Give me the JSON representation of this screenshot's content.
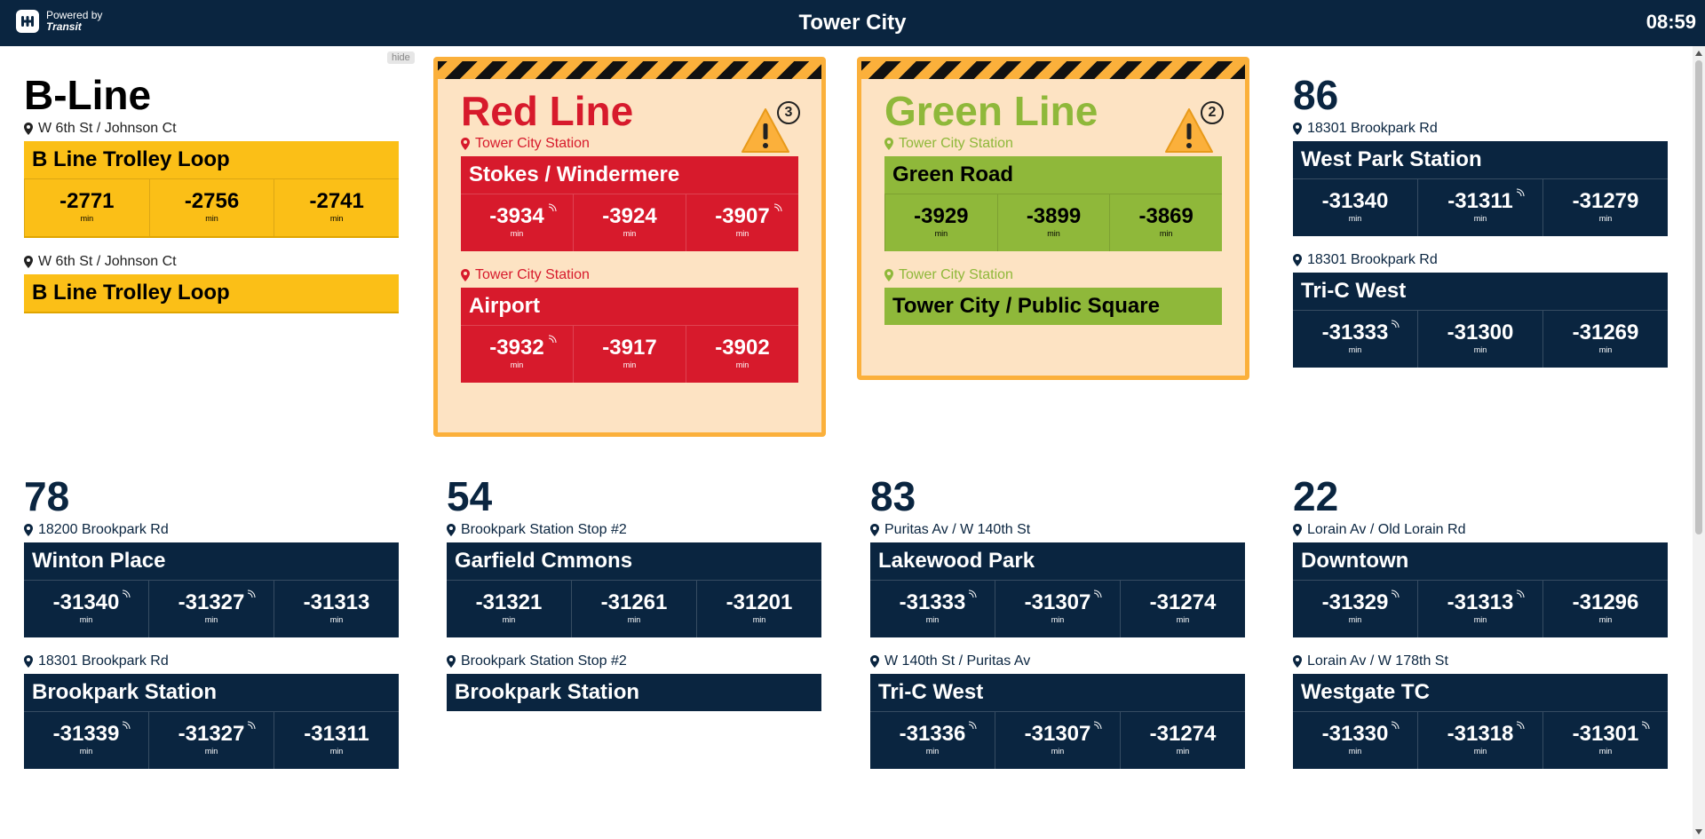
{
  "header": {
    "powered_by": "Powered by",
    "brand": "Transit",
    "title": "Tower City",
    "clock": "08:59"
  },
  "hide_label": "hide",
  "min_label": "min",
  "colors": {
    "navy": "#0a2540",
    "yellow": "#fbbf17",
    "red": "#d71a2c",
    "green": "#8fb83a",
    "alert_bg": "#fde3c3",
    "alert_border": "#fbb03b"
  },
  "bline": {
    "name": "B-Line",
    "groups": [
      {
        "stop": "W 6th St / Johnson Ct",
        "destination": "B Line Trolley Loop",
        "times": [
          "-2771",
          "-2756",
          "-2741"
        ]
      },
      {
        "stop": "W 6th St / Johnson Ct",
        "destination": "B Line Trolley Loop"
      }
    ]
  },
  "red_line": {
    "name": "Red Line",
    "alert_count": "3",
    "groups": [
      {
        "stop": "Tower City Station",
        "destination": "Stokes / Windermere",
        "times": [
          "-3934",
          "-3924",
          "-3907"
        ]
      },
      {
        "stop": "Tower City Station",
        "destination": "Airport",
        "times": [
          "-3932",
          "-3917",
          "-3902"
        ]
      }
    ]
  },
  "green_line": {
    "name": "Green Line",
    "alert_count": "2",
    "groups": [
      {
        "stop": "Tower City Station",
        "destination": "Green Road",
        "times": [
          "-3929",
          "-3899",
          "-3869"
        ]
      },
      {
        "stop": "Tower City Station",
        "destination": "Tower City / Public Square"
      }
    ]
  },
  "route86": {
    "name": "86",
    "groups": [
      {
        "stop": "18301 Brookpark Rd",
        "destination": "West Park Station",
        "times": [
          "-31340",
          "-31311",
          "-31279"
        ]
      },
      {
        "stop": "18301 Brookpark Rd",
        "destination": "Tri-C West",
        "times": [
          "-31333",
          "-31300",
          "-31269"
        ]
      }
    ]
  },
  "route78": {
    "name": "78",
    "groups": [
      {
        "stop": "18200 Brookpark Rd",
        "destination": "Winton Place",
        "times": [
          "-31340",
          "-31327",
          "-31313"
        ]
      },
      {
        "stop": "18301 Brookpark Rd",
        "destination": "Brookpark Station",
        "times": [
          "-31339",
          "-31327",
          "-31311"
        ]
      }
    ]
  },
  "route54": {
    "name": "54",
    "groups": [
      {
        "stop": "Brookpark Station Stop #2",
        "destination": "Garfield Cmmons",
        "times": [
          "-31321",
          "-31261",
          "-31201"
        ]
      },
      {
        "stop": "Brookpark Station Stop #2",
        "destination": "Brookpark Station"
      }
    ]
  },
  "route83": {
    "name": "83",
    "groups": [
      {
        "stop": "Puritas Av / W 140th St",
        "destination": "Lakewood Park",
        "times": [
          "-31333",
          "-31307",
          "-31274"
        ]
      },
      {
        "stop": "W 140th St / Puritas Av",
        "destination": "Tri-C West",
        "times": [
          "-31336",
          "-31307",
          "-31274"
        ]
      }
    ]
  },
  "route22": {
    "name": "22",
    "groups": [
      {
        "stop": "Lorain Av / Old Lorain Rd",
        "destination": "Downtown",
        "times": [
          "-31329",
          "-31313",
          "-31296"
        ]
      },
      {
        "stop": "Lorain Av / W 178th St",
        "destination": "Westgate TC",
        "times": [
          "-31330",
          "-31318",
          "-31301"
        ]
      }
    ]
  }
}
